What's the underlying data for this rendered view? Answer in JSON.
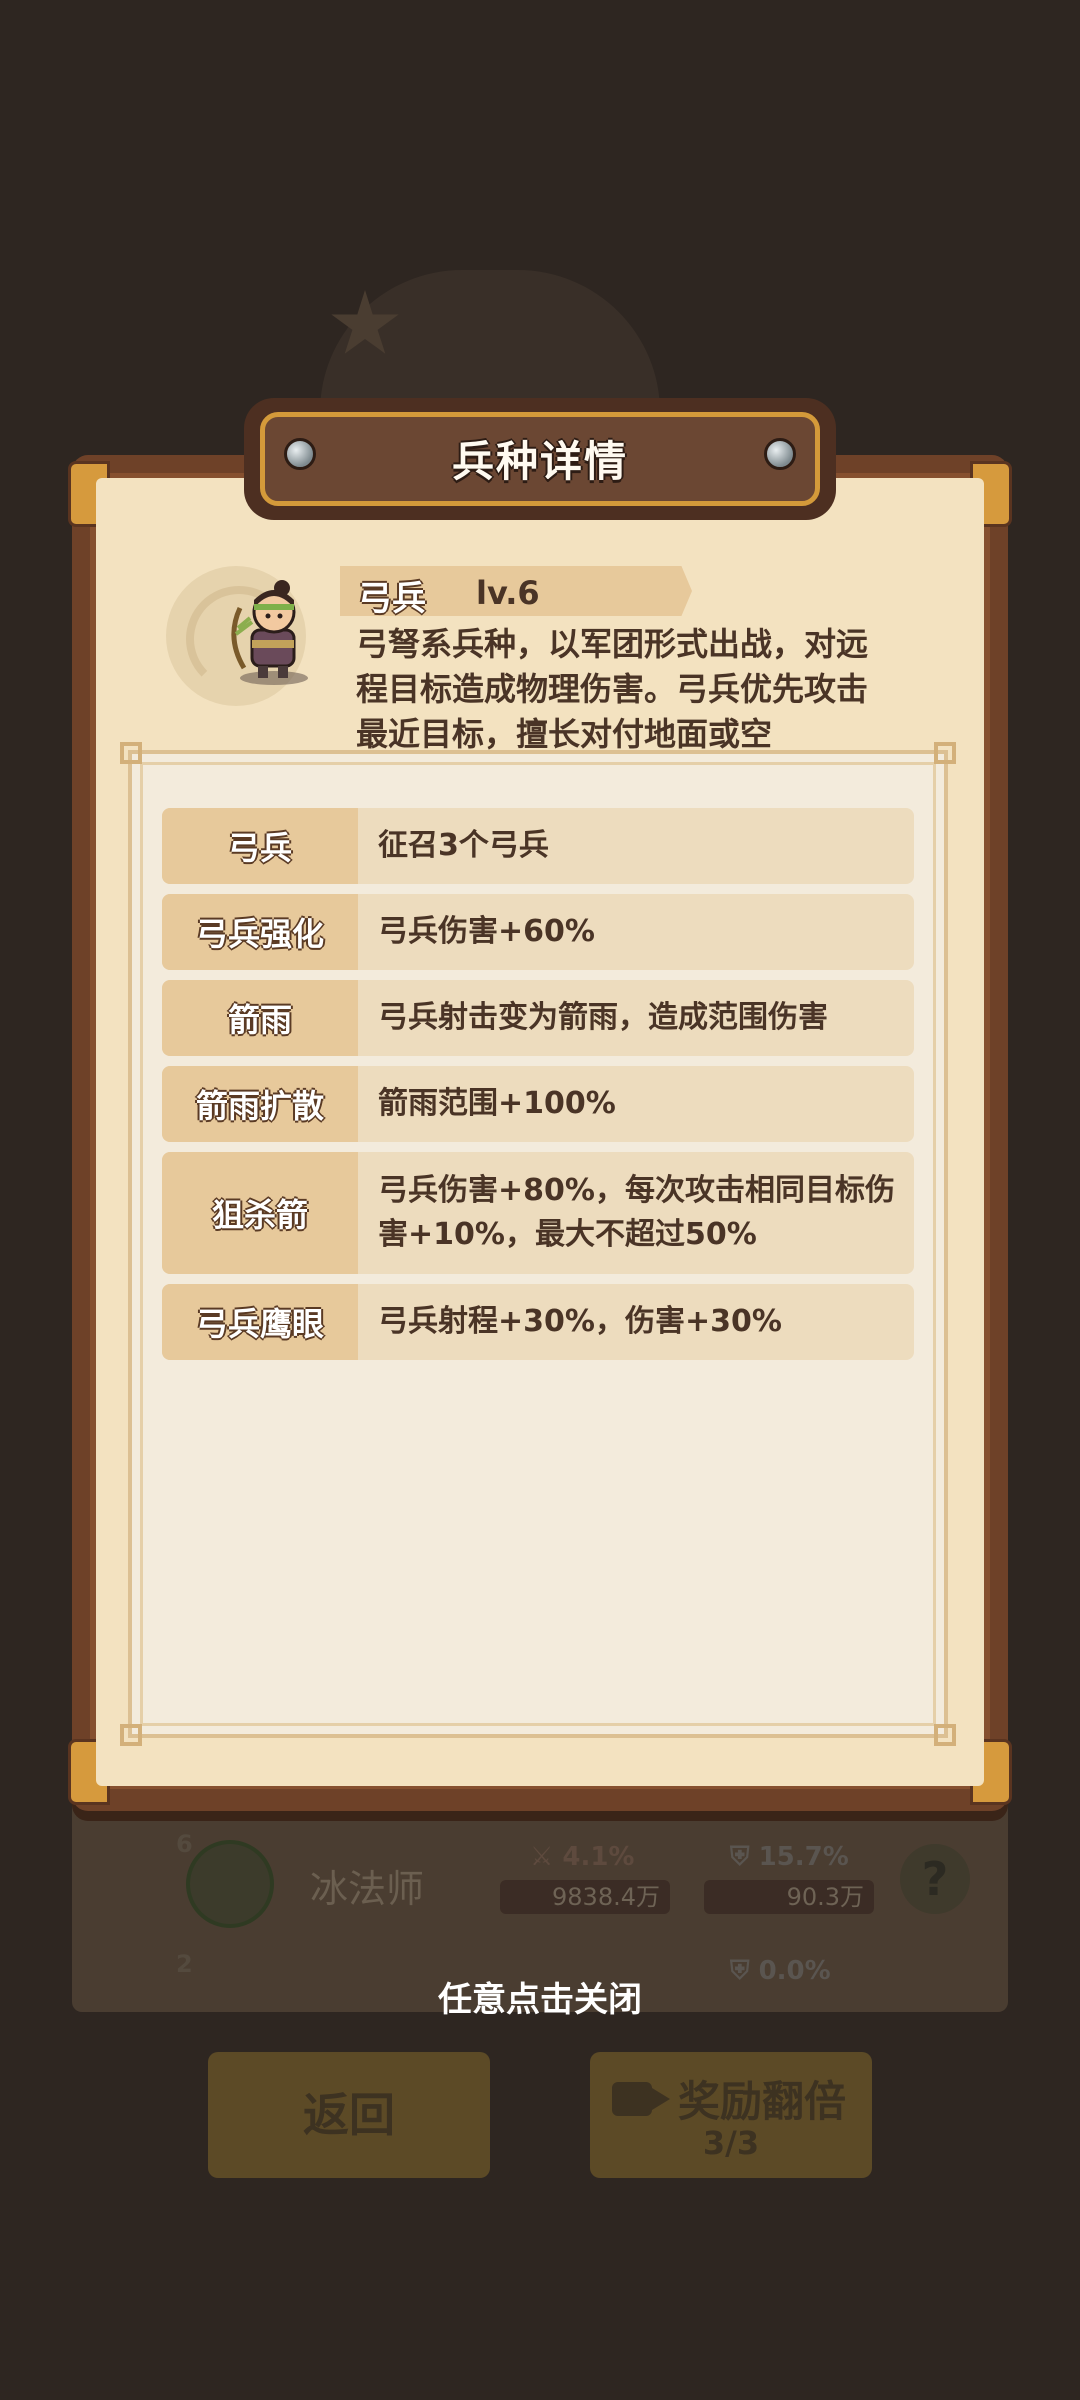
{
  "background": {
    "list_row_1": {
      "level": "6",
      "name": "冰法师",
      "attack_pct": "4.1%",
      "attack_value": "9838.4万",
      "defense_pct": "15.7%",
      "defense_value": "90.3万",
      "help": "?"
    },
    "list_row_2": {
      "level": "2",
      "defense_pct": "0.0%"
    },
    "back_button": "返回",
    "reward_button": {
      "label": "奖励翻倍",
      "count": "3/3"
    }
  },
  "modal": {
    "title": "兵种详情",
    "unit": {
      "name": "弓兵",
      "level": "lv.6",
      "description": "弓弩系兵种，以军团形式出战，对远程目标造成物理伤害。弓兵优先攻击最近目标，擅长对付地面或空"
    },
    "upgrades": [
      {
        "name": "弓兵",
        "desc": "征召3个弓兵"
      },
      {
        "name": "弓兵强化",
        "desc": "弓兵伤害+60%"
      },
      {
        "name": "箭雨",
        "desc": "弓兵射击变为箭雨，造成范围伤害"
      },
      {
        "name": "箭雨扩散",
        "desc": "箭雨范围+100%"
      },
      {
        "name": "狙杀箭",
        "desc": "弓兵伤害+80%，每次攻击相同目标伤害+10%，最大不超过50%"
      },
      {
        "name": "弓兵鹰眼",
        "desc": "弓兵射程+30%，伤害+30%"
      }
    ]
  },
  "close_hint": "任意点击关闭",
  "colors": {
    "overlay_bg": "#2e2621",
    "parchment": "#f3e2c0",
    "label_bg": "#e7c99b",
    "text_dark": "#4a3426"
  }
}
